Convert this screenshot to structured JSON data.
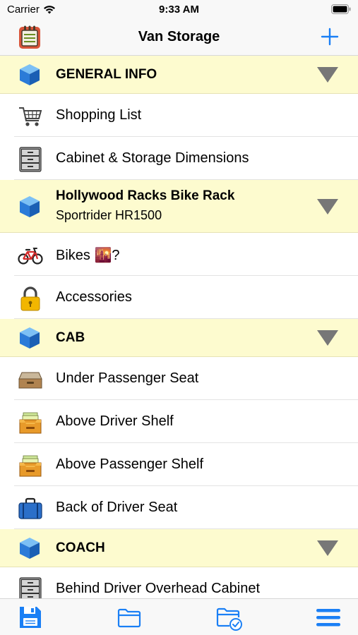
{
  "status_bar": {
    "carrier": "Carrier",
    "time": "9:33 AM"
  },
  "nav": {
    "title": "Van Storage",
    "left_icon": "notepad-icon",
    "add_icon": "plus-icon"
  },
  "colors": {
    "section_bg": "#fdfbcf",
    "accent": "#1a7ff5",
    "chevron": "#777777"
  },
  "sections": [
    {
      "title": "GENERAL INFO",
      "items": [
        {
          "label": "Shopping List",
          "icon": "shopping-cart-icon"
        },
        {
          "label": "Cabinet & Storage Dimensions",
          "icon": "file-cabinet-icon"
        }
      ]
    },
    {
      "title": "Hollywood Racks Bike Rack",
      "subtitle": "Sportrider HR1500",
      "items": [
        {
          "label": "Bikes 🌇?",
          "icon": "bicycle-icon"
        },
        {
          "label": "Accessories",
          "icon": "lock-icon"
        }
      ]
    },
    {
      "title": "CAB",
      "items": [
        {
          "label": "Under Passenger Seat",
          "icon": "drawer-icon"
        },
        {
          "label": "Above Driver Shelf",
          "icon": "file-tray-icon"
        },
        {
          "label": "Above Passenger Shelf",
          "icon": "file-tray-icon"
        },
        {
          "label": "Back of Driver Seat",
          "icon": "briefcase-icon"
        }
      ]
    },
    {
      "title": "COACH",
      "items": [
        {
          "label": "Behind Driver Overhead Cabinet",
          "icon": "file-cabinet-icon"
        }
      ]
    }
  ],
  "tab_bar": {
    "items": [
      {
        "icon": "save-icon"
      },
      {
        "icon": "folder-icon"
      },
      {
        "icon": "folder-check-icon"
      },
      {
        "icon": "menu-icon"
      }
    ]
  }
}
